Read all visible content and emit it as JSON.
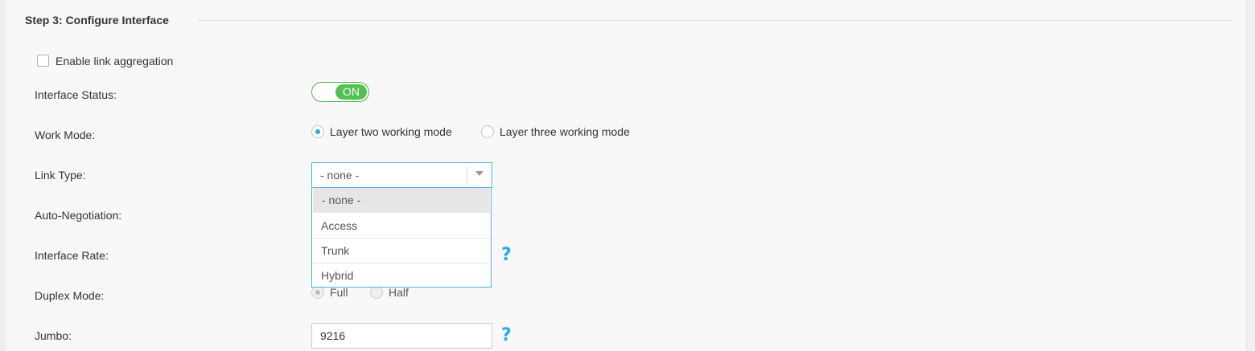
{
  "section": {
    "title": "Step 3: Configure Interface"
  },
  "link_aggregation": {
    "label": "Enable link aggregation",
    "checked": false
  },
  "labels": {
    "interface_status": "Interface Status:",
    "work_mode": "Work Mode:",
    "link_type": "Link Type:",
    "auto_negotiation": "Auto-Negotiation:",
    "interface_rate": "Interface Rate:",
    "duplex_mode": "Duplex Mode:",
    "jumbo": "Jumbo:"
  },
  "interface_status": {
    "toggle_label": "ON",
    "on": true
  },
  "work_mode": {
    "options": [
      "Layer two working mode",
      "Layer three working mode"
    ],
    "selected": "Layer two working mode"
  },
  "link_type": {
    "value": "- none -",
    "options": [
      "- none -",
      "Access",
      "Trunk",
      "Hybrid"
    ],
    "highlighted": "- none -"
  },
  "duplex_mode": {
    "options": [
      "Full",
      "Half"
    ],
    "selected": "Full",
    "disabled": true
  },
  "jumbo": {
    "value": "9216"
  },
  "help": {
    "glyph": "?"
  },
  "colors": {
    "accent": "#2aa8e8",
    "toggle_green": "#52c14f",
    "select_border": "#4db3e6"
  }
}
